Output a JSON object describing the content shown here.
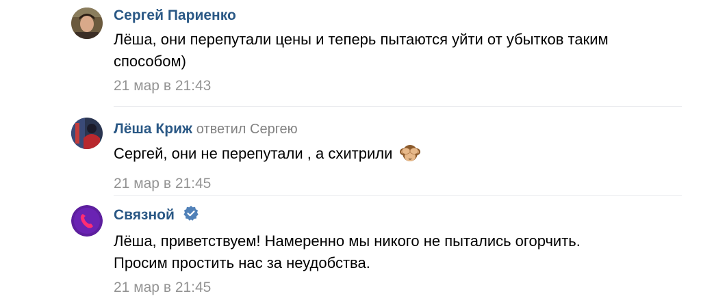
{
  "comments": [
    {
      "author": "Сергей Париенко",
      "text": "Лёша, они перепутали цены и теперь пытаются уйти от убытков таким способом)",
      "date": "21 мар в 21:43"
    },
    {
      "author": "Лёша Криж",
      "replied_label": "ответил",
      "replied_to": "Сергею",
      "text": "Сергей, они не перепутали , а схитрили",
      "emoji": "see-no-evil-monkey",
      "date": "21 мар в 21:45"
    },
    {
      "author": "Связной",
      "verified_icon": "verified-check-icon",
      "text_line1": "Лёша, приветствуем! Намеренно мы никого не пытались огорчить.",
      "text_line2": "Просим простить нас за неудобства.",
      "date": "21 мар в 21:45"
    }
  ],
  "colors": {
    "author_link": "#2a5885",
    "meta_gray": "#939393",
    "separator": "#e7e8ec",
    "verified_blue": "#5181b8",
    "svyaznoy_purple": "#5d1f9e"
  }
}
